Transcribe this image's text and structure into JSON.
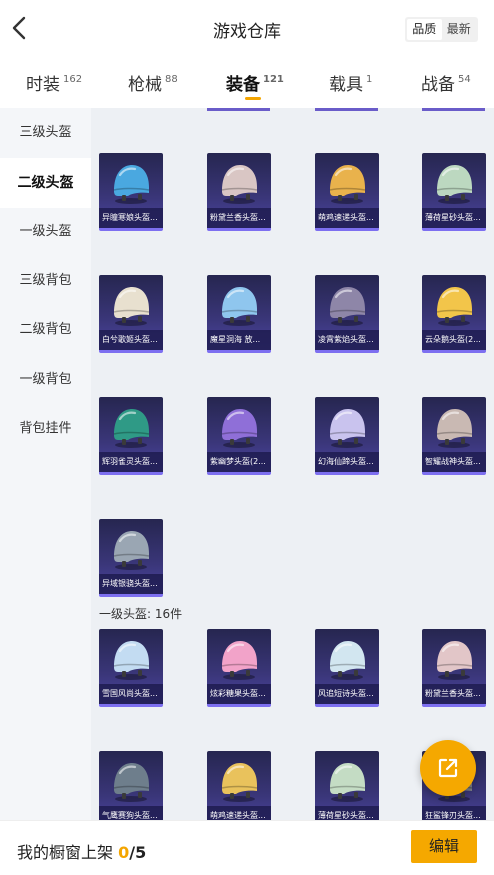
{
  "header": {
    "title": "游戏仓库",
    "sort_options": [
      "品质",
      "最新"
    ],
    "active_sort": "品质"
  },
  "tabs": [
    {
      "label": "时装",
      "count": "162"
    },
    {
      "label": "枪械",
      "count": "88"
    },
    {
      "label": "装备",
      "count": "121"
    },
    {
      "label": "载具",
      "count": "1"
    },
    {
      "label": "战备",
      "count": "54"
    }
  ],
  "sidebar": {
    "categories": [
      "三级头盔",
      "二级头盔",
      "一级头盔",
      "三级背包",
      "二级背包",
      "一级背包",
      "背包挂件"
    ],
    "active_index": 1
  },
  "content": {
    "level2_items": [
      {
        "name": "异瞳寒娘头盔...",
        "icon": "helmet-icon",
        "color": "#4aa8e0"
      },
      {
        "name": "粉黛兰香头盔...",
        "icon": "helmet-icon",
        "color": "#d9c6c4"
      },
      {
        "name": "萌鸡速递头盔...",
        "icon": "helmet-icon",
        "color": "#e9b24c"
      },
      {
        "name": "薄荷星砂头盔...",
        "icon": "helmet-icon",
        "color": "#bcd8c0"
      },
      {
        "name": "白兮歌姬头盔...",
        "icon": "helmet-icon",
        "color": "#e8e0cf"
      },
      {
        "name": "魔星洞海 放...",
        "icon": "helmet-icon",
        "color": "#8fc6ee"
      },
      {
        "name": "凌霄紫焰头盔...",
        "icon": "helmet-icon",
        "color": "#8e86a8"
      },
      {
        "name": "云朵鹅头盔(2...",
        "icon": "helmet-icon",
        "color": "#f2c54a"
      },
      {
        "name": "辉羽雀灵头盔...",
        "icon": "helmet-icon",
        "color": "#2f9a86"
      },
      {
        "name": "紫幽梦头盔(2...",
        "icon": "helmet-icon",
        "color": "#8f6fd8"
      },
      {
        "name": "幻海仙蹄头盔...",
        "icon": "helmet-icon",
        "color": "#c9c3ee"
      },
      {
        "name": "智耀战神头盔...",
        "icon": "helmet-icon",
        "color": "#c9b9b3"
      },
      {
        "name": "异域银骁头盔...",
        "icon": "helmet-icon",
        "color": "#9aa6b3"
      }
    ],
    "level1_label": "一级头盔: 16件",
    "level1_items": [
      {
        "name": "雪国风尚头盔...",
        "icon": "helmet-icon",
        "color": "#c3dcf2"
      },
      {
        "name": "炫彩糖果头盔...",
        "icon": "helmet-icon",
        "color": "#f2a3c9"
      },
      {
        "name": "风追短诗头盔...",
        "icon": "helmet-icon",
        "color": "#d2e6f0"
      },
      {
        "name": "粉黛兰香头盔...",
        "icon": "helmet-icon",
        "color": "#e2c6c8"
      },
      {
        "name": "气鹰赛狗头盔...",
        "icon": "helmet-icon",
        "color": "#6e7e8c"
      },
      {
        "name": "萌鸡速递头盔...",
        "icon": "helmet-icon",
        "color": "#e9c25c"
      },
      {
        "name": "薄荷星砂头盔...",
        "icon": "helmet-icon",
        "color": "#c4dcc4"
      },
      {
        "name": "狂鲨锋刃头盔...",
        "icon": "helmet-icon",
        "color": "#7b7e86"
      }
    ]
  },
  "bottom": {
    "shelf_label": "我的橱窗上架",
    "shelf_count": "0",
    "shelf_total": "/5",
    "edit_label": "编辑"
  },
  "colors": {
    "accent": "#f5a800",
    "card_dark": "#262650",
    "card_light": "#4b44a0"
  }
}
